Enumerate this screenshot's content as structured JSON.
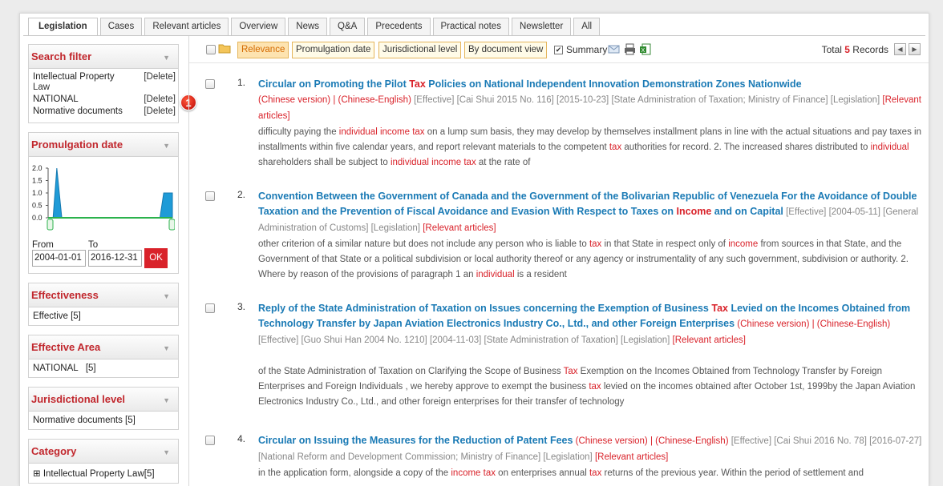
{
  "tabs": [
    "Legislation",
    "Cases",
    "Relevant articles",
    "Overview",
    "News",
    "Q&A",
    "Precedents",
    "Practical notes",
    "Newsletter",
    "All"
  ],
  "sidebar": {
    "search_filter": {
      "title": "Search filter",
      "items": [
        {
          "label1": "Intellectual Property",
          "label2": "Law",
          "action": "[Delete]"
        },
        {
          "label1": "NATIONAL",
          "action": "[Delete]"
        },
        {
          "label1": "Normative documents",
          "action": "[Delete]"
        }
      ]
    },
    "promulgation": {
      "title": "Promulgation date",
      "y_ticks": [
        "2.0",
        "1.5",
        "1.0",
        "0.5",
        "0.0"
      ],
      "from_label": "From",
      "to_label": "To",
      "from_value": "2004-01-01",
      "to_value": "2016-12-31",
      "ok_label": "OK"
    },
    "effectiveness": {
      "title": "Effectiveness",
      "item": "Effective [5]"
    },
    "effective_area": {
      "title": "Effective Area",
      "item": "NATIONAL   [5]"
    },
    "jurisdictional": {
      "title": "Jurisdictional level",
      "item": "Normative documents [5]"
    },
    "category": {
      "title": "Category",
      "item": "⊞ Intellectual Property Law[5]"
    }
  },
  "badge": "1",
  "toolbar": {
    "sort_buttons": [
      "Relevance",
      "Promulgation date",
      "Jurisdictional level",
      "By document view"
    ],
    "summary_label": "Summary",
    "total_prefix": "Total ",
    "total_count": "5",
    "total_suffix": " Records"
  },
  "chart_data": {
    "type": "area",
    "title": "",
    "ylim": [
      0,
      2
    ],
    "y_ticks": [
      0,
      0.5,
      1,
      1.5,
      2
    ],
    "from": "2004-01-01",
    "to": "2016-12-31",
    "note": "small activity histogram; values estimated",
    "points": [
      [
        0,
        0
      ],
      [
        0.04,
        0
      ],
      [
        0.07,
        2
      ],
      [
        0.11,
        0
      ],
      [
        0.88,
        0
      ],
      [
        0.9,
        0
      ],
      [
        0.93,
        1
      ],
      [
        1,
        1
      ]
    ]
  },
  "records": [
    {
      "num": "1.",
      "t1": "Circular on Promoting the Pilot ",
      "t_kw": "Tax",
      "t2": " Policies on National Independent Innovation Demonstration Zones Nationwide",
      "meta1": "(Chinese version) | (Chinese-English)",
      "meta2": " [Effective] [Cai Shui 2015 No. 116] [2015-10-23] [State Administration of Taxation; Ministry of Finance] [Legislation] ",
      "rel": "[Relevant articles]",
      "snippet": [
        "difficulty paying the ",
        "individual income tax",
        " on a lump sum basis, they may develop by themselves installment plans in line with the actual situations and pay taxes in installments within five calendar years, and report relevant materials to the competent ",
        "tax",
        " authorities for record. 2. The increased shares distributed to ",
        "individual",
        " shareholders shall be subject to ",
        "individual income tax",
        " at the rate of"
      ]
    },
    {
      "num": "2.",
      "t1": "Convention Between the Government of Canada and the Government of the Bolivarian Republic of Venezuela For the Avoidance of Double Taxation and the Prevention of Fiscal Avoidance and Evasion With Respect to Taxes on ",
      "t_kw": "Income",
      "t2": " and on Capital",
      "meta1": "",
      "meta2": "  [Effective] [2004-05-11] [General Administration of Customs] [Legislation] ",
      "rel": "[Relevant articles]",
      "snippet": [
        "other criterion of a similar nature but does not include any person who is liable to ",
        "tax",
        " in that State in respect only of ",
        "income",
        " from sources in that State, and the Government of that State or a political subdivision or local authority thereof or any agency or instrumentality of any such government, subdivision or authority. 2. Where by reason of the provisions of paragraph 1 an ",
        "individual",
        " is a resident"
      ]
    },
    {
      "num": "3.",
      "t1": "Reply of the State Administration of Taxation on Issues concerning the Exemption of Business ",
      "t_kw": "Tax",
      "t2": " Levied on the Incomes Obtained from Technology Transfer by Japan Aviation Electronics Industry Co., Ltd., and other Foreign Enterprises",
      "meta1": " (Chinese version) | (Chinese-English)",
      "meta2": " [Effective] [Guo Shui Han 2004 No. 1210] [2004-11-03] [State Administration of Taxation] [Legislation] ",
      "rel": "[Relevant articles]",
      "snippet": [
        "of the State Administration of Taxation on Clarifying the Scope of Business ",
        "Tax",
        " Exemption on the Incomes Obtained from Technology Transfer by Foreign Enterprises and Foreign Individuals , we hereby approve to exempt the business ",
        "tax",
        " levied on the incomes obtained after October 1st, 1999by the Japan Aviation Electronics Industry Co., Ltd., and other foreign enterprises for their transfer of technology"
      ]
    },
    {
      "num": "4.",
      "t1": "Circular on Issuing the Measures for the Reduction of Patent Fees",
      "t_kw": "",
      "t2": "",
      "meta1": " (Chinese version) | (Chinese-English)",
      "meta2": " [Effective] [Cai Shui 2016 No. 78] [2016-07-27] [National Reform and Development Commission; Ministry of Finance] [Legislation] ",
      "rel": "[Relevant articles]",
      "snippet": [
        "in the application form, alongside a copy of the ",
        "income tax",
        " on enterprises annual ",
        "tax",
        " returns of the previous year. Within the period of settlement and"
      ]
    }
  ]
}
